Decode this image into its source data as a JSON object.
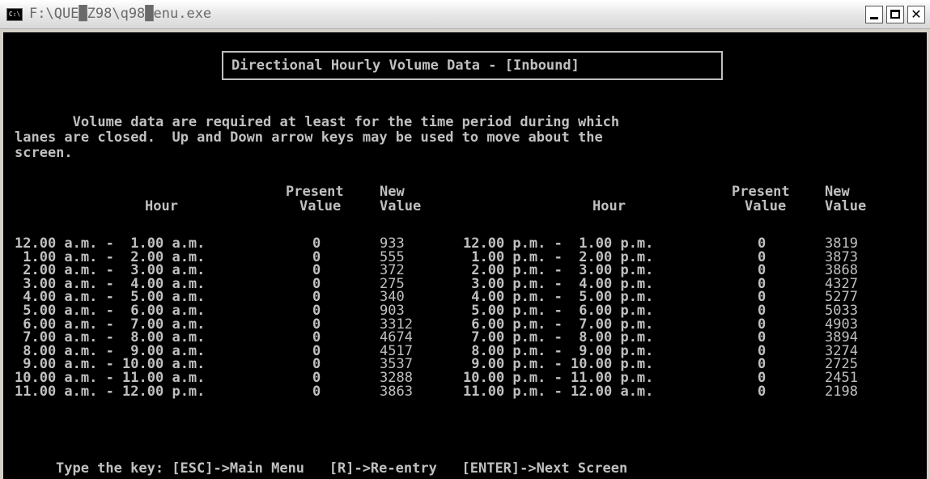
{
  "window": {
    "title": "F:\\QUE█Z98\\q98█enu.exe",
    "icon": "C:\\"
  },
  "screen": {
    "heading": "Directional Hourly Volume Data - [Inbound]",
    "instructions": [
      "       Volume data are required at least for the time period during which",
      "lanes are closed.  Up and Down arrow keys may be used to move about the",
      "screen."
    ],
    "left_headers": {
      "present": "Present",
      "new": "New",
      "hour": "Hour",
      "value1": "Value",
      "value2": "Value"
    },
    "right_headers": {
      "present": "Present",
      "new": "New",
      "hour": "Hour",
      "value1": "Value",
      "value2": "Value"
    },
    "left_rows": [
      {
        "hour": "12.00 a.m. -  1.00 a.m.",
        "present": "0",
        "new": "933"
      },
      {
        "hour": " 1.00 a.m. -  2.00 a.m.",
        "present": "0",
        "new": "555"
      },
      {
        "hour": " 2.00 a.m. -  3.00 a.m.",
        "present": "0",
        "new": "372"
      },
      {
        "hour": " 3.00 a.m. -  4.00 a.m.",
        "present": "0",
        "new": "275"
      },
      {
        "hour": " 4.00 a.m. -  5.00 a.m.",
        "present": "0",
        "new": "340"
      },
      {
        "hour": " 5.00 a.m. -  6.00 a.m.",
        "present": "0",
        "new": "903"
      },
      {
        "hour": " 6.00 a.m. -  7.00 a.m.",
        "present": "0",
        "new": "3312"
      },
      {
        "hour": " 7.00 a.m. -  8.00 a.m.",
        "present": "0",
        "new": "4674"
      },
      {
        "hour": " 8.00 a.m. -  9.00 a.m.",
        "present": "0",
        "new": "4517"
      },
      {
        "hour": " 9.00 a.m. - 10.00 a.m.",
        "present": "0",
        "new": "3537"
      },
      {
        "hour": "10.00 a.m. - 11.00 a.m.",
        "present": "0",
        "new": "3288"
      },
      {
        "hour": "11.00 a.m. - 12.00 p.m.",
        "present": "0",
        "new": "3863"
      }
    ],
    "right_rows": [
      {
        "hour": "12.00 p.m. -  1.00 p.m.",
        "present": "0",
        "new": "3819"
      },
      {
        "hour": " 1.00 p.m. -  2.00 p.m.",
        "present": "0",
        "new": "3873"
      },
      {
        "hour": " 2.00 p.m. -  3.00 p.m.",
        "present": "0",
        "new": "3868"
      },
      {
        "hour": " 3.00 p.m. -  4.00 p.m.",
        "present": "0",
        "new": "4327"
      },
      {
        "hour": " 4.00 p.m. -  5.00 p.m.",
        "present": "0",
        "new": "5277"
      },
      {
        "hour": " 5.00 p.m. -  6.00 p.m.",
        "present": "0",
        "new": "5033"
      },
      {
        "hour": " 6.00 p.m. -  7.00 p.m.",
        "present": "0",
        "new": "4903"
      },
      {
        "hour": " 7.00 p.m. -  8.00 p.m.",
        "present": "0",
        "new": "3894"
      },
      {
        "hour": " 8.00 p.m. -  9.00 p.m.",
        "present": "0",
        "new": "3274"
      },
      {
        "hour": " 9.00 p.m. - 10.00 p.m.",
        "present": "0",
        "new": "2725"
      },
      {
        "hour": "10.00 p.m. - 11.00 p.m.",
        "present": "0",
        "new": "2451"
      },
      {
        "hour": "11.00 p.m. - 12.00 a.m.",
        "present": "0",
        "new": "2198"
      }
    ],
    "footer": "Type the key: [ESC]->Main Menu   [R]->Re-entry   [ENTER]->Next Screen"
  },
  "colors": {
    "console_bg": "#000000",
    "console_fg": "#c0c0c0"
  }
}
